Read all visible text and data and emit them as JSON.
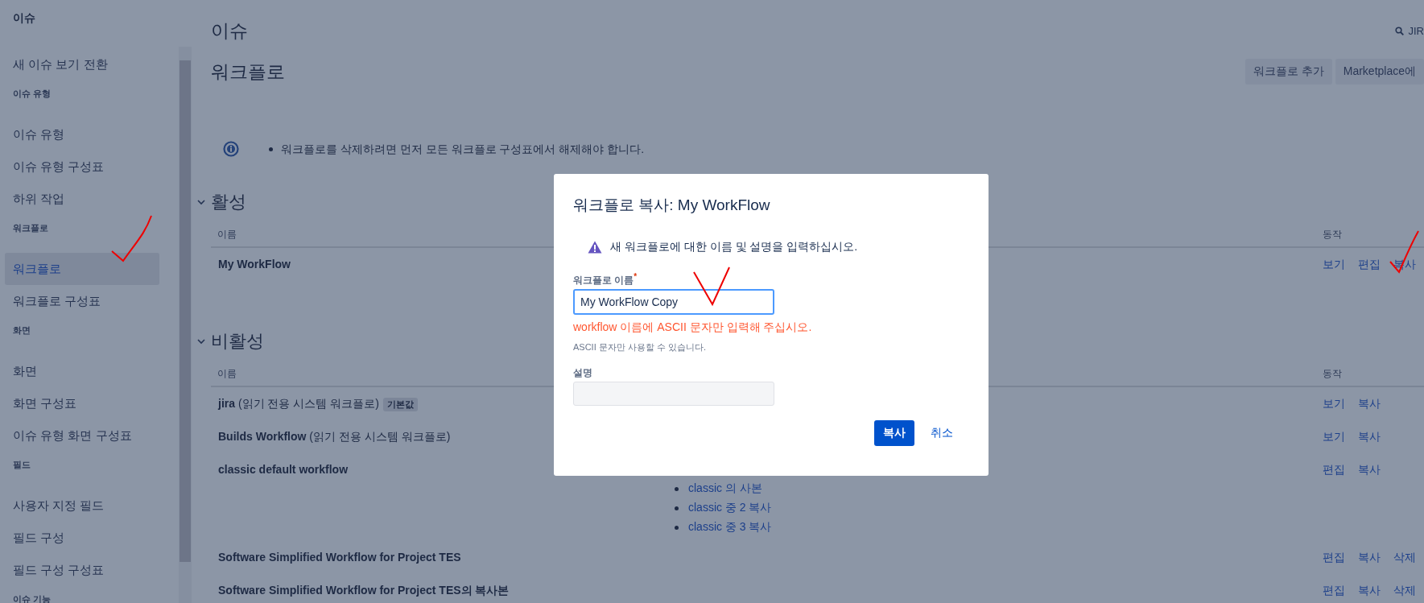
{
  "sidebar": {
    "title": "이슈",
    "entries": [
      {
        "kind": "link",
        "label": "새 이슈 보기 전환",
        "selected": false
      },
      {
        "kind": "heading",
        "label": "이슈 유형"
      },
      {
        "kind": "link",
        "label": "이슈 유형",
        "selected": false
      },
      {
        "kind": "link",
        "label": "이슈 유형 구성표",
        "selected": false
      },
      {
        "kind": "link",
        "label": "하위 작업",
        "selected": false
      },
      {
        "kind": "heading",
        "label": "워크플로"
      },
      {
        "kind": "link",
        "label": "워크플로",
        "selected": true
      },
      {
        "kind": "link",
        "label": "워크플로 구성표",
        "selected": false
      },
      {
        "kind": "heading",
        "label": "화면"
      },
      {
        "kind": "link",
        "label": "화면",
        "selected": false
      },
      {
        "kind": "link",
        "label": "화면 구성표",
        "selected": false
      },
      {
        "kind": "link",
        "label": "이슈 유형 화면 구성표",
        "selected": false
      },
      {
        "kind": "heading",
        "label": "필드"
      },
      {
        "kind": "link",
        "label": "사용자 지정 필드",
        "selected": false
      },
      {
        "kind": "link",
        "label": "필드 구성",
        "selected": false
      },
      {
        "kind": "link",
        "label": "필드 구성 구성표",
        "selected": false
      },
      {
        "kind": "heading",
        "label": "이슈 기능"
      }
    ]
  },
  "header": {
    "title": "이슈",
    "search": "JIR",
    "heading": "워크플로",
    "buttons": [
      "워크플로 추가",
      "Marketplace에"
    ]
  },
  "info": "워크플로를 삭제하려면 먼저 모든 워크플로 구성표에서 해제해야 합니다.",
  "sections": [
    {
      "title": "활성",
      "expanded": true,
      "columns": [
        "이름",
        "동작"
      ],
      "rows": [
        {
          "name": "**My WorkFlow**",
          "actions": [
            "보기",
            "편집",
            "복사"
          ]
        }
      ]
    },
    {
      "title": "비활성",
      "expanded": true,
      "columns": [
        "이름",
        "동작"
      ],
      "rows": [
        {
          "name": "**jira** (읽기 전용 시스템 워크플로)",
          "badge": "기본값",
          "actions": [
            "보기",
            "복사"
          ]
        },
        {
          "name": "**Builds Workflow** (읽기 전용 시스템 워크플로)",
          "actions": [
            "보기",
            "복사"
          ]
        },
        {
          "name": "**classic default workflow**",
          "schemes": [
            "classic 의 사본",
            "classic 중 2 복사",
            "classic 중 3 복사"
          ],
          "actions": [
            "편집",
            "복사"
          ]
        },
        {
          "name": "**Software Simplified Workflow for Project TES**",
          "actions": [
            "편집",
            "복사",
            "삭제"
          ]
        },
        {
          "name": "**Software Simplified Workflow for Project TES의 복사본**",
          "actions": [
            "편집",
            "복사",
            "삭제"
          ]
        }
      ]
    }
  ],
  "dialog": {
    "title": "워크플로 복사: My WorkFlow",
    "warning": "새 워크플로에 대한 이름 및 설명을 입력하십시오.",
    "name_label": "워크플로 이름",
    "required_mark": "*",
    "name_value": "My WorkFlow Copy",
    "error": "workflow 이름에 ASCII 문자만 입력해 주십시오.",
    "hint": "ASCII 문자만 사용할 수 있습니다.",
    "description_label": "설명",
    "buttons": [
      {
        "label": "복사",
        "kind": "primary"
      },
      {
        "label": "취소",
        "kind": "link"
      }
    ]
  }
}
